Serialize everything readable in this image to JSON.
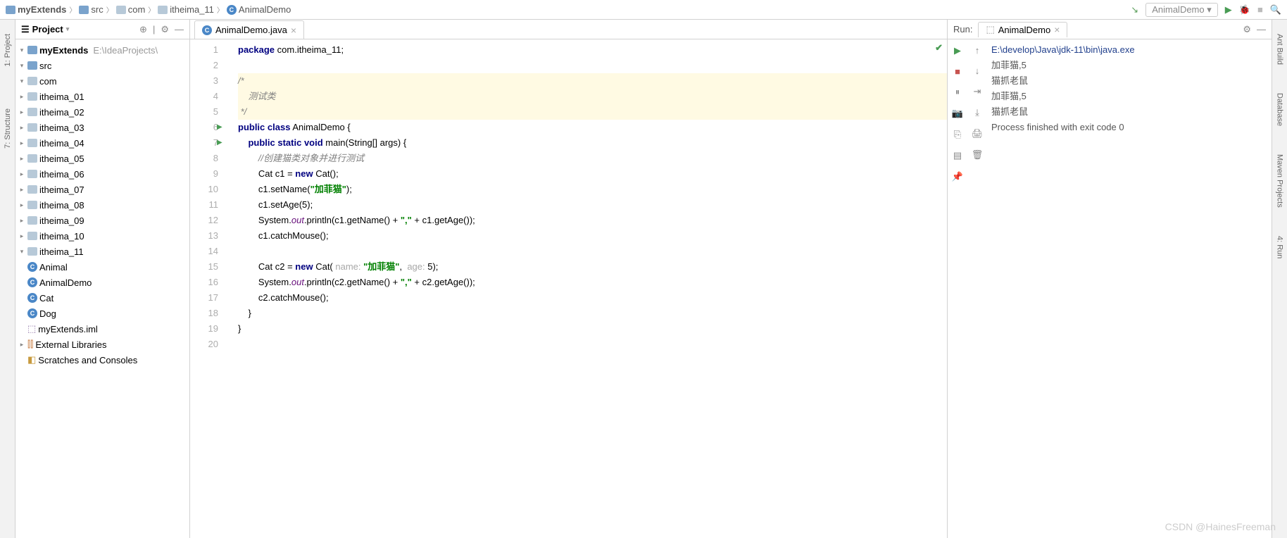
{
  "breadcrumb": [
    "myExtends",
    "src",
    "com",
    "itheima_11",
    "AnimalDemo"
  ],
  "breadcrumb_run_config": "AnimalDemo",
  "project_panel": {
    "title": "Project",
    "root": {
      "name": "myExtends",
      "path": "E:\\IdeaProjects\\"
    },
    "src": "src",
    "com": "com",
    "packages": [
      "itheima_01",
      "itheima_02",
      "itheima_03",
      "itheima_04",
      "itheima_05",
      "itheima_06",
      "itheima_07",
      "itheima_08",
      "itheima_09",
      "itheima_10",
      "itheima_11"
    ],
    "classes": [
      "Animal",
      "AnimalDemo",
      "Cat",
      "Dog"
    ],
    "iml": "myExtends.iml",
    "ext_libs": "External Libraries",
    "scratches": "Scratches and Consoles"
  },
  "editor": {
    "tab_name": "AnimalDemo.java",
    "lines": {
      "l1": {
        "pre": "",
        "kw": "package",
        "rest": " com.itheima_11;"
      },
      "l3": "/*",
      "l4": "    测试类",
      "l5": " */",
      "l6_pre": "",
      "l6_kw1": "public",
      "l6_kw2": "class",
      "l6_rest": " AnimalDemo {",
      "l7_kw1": "public",
      "l7_kw2": "static",
      "l7_kw3": "void",
      "l7_rest": " main(String[] args) {",
      "l8": "        //创建猫类对象并进行测试",
      "l9_a": "        Cat c1 = ",
      "l9_kw": "new",
      "l9_b": " Cat();",
      "l10_a": "        c1.setName(",
      "l10_s": "\"加菲猫\"",
      "l10_b": ");",
      "l11": "        c1.setAge(5);",
      "l12_a": "        System.",
      "l12_f": "out",
      "l12_b": ".println(c1.getName() + ",
      "l12_s": "\",\"",
      "l12_c": " + c1.getAge());",
      "l13": "        c1.catchMouse();",
      "l15_a": "        Cat c2 = ",
      "l15_kw": "new",
      "l15_b": " Cat( ",
      "l15_h1": "name: ",
      "l15_s": "\"加菲猫\"",
      "l15_c": ",  ",
      "l15_h2": "age: ",
      "l15_d": "5);",
      "l16_a": "        System.",
      "l16_f": "out",
      "l16_b": ".println(c2.getName() + ",
      "l16_s": "\",\"",
      "l16_c": " + c2.getAge());",
      "l17": "        c2.catchMouse();",
      "l18": "    }",
      "l19": "}"
    },
    "line_numbers": [
      "1",
      "2",
      "3",
      "4",
      "5",
      "6",
      "7",
      "8",
      "9",
      "10",
      "11",
      "12",
      "13",
      "14",
      "15",
      "16",
      "17",
      "18",
      "19",
      "20"
    ]
  },
  "run": {
    "label": "Run:",
    "tab": "AnimalDemo",
    "console": [
      {
        "cls": "path",
        "text": "E:\\develop\\Java\\jdk-11\\bin\\java.exe "
      },
      {
        "cls": "",
        "text": "加菲猫,5"
      },
      {
        "cls": "",
        "text": "猫抓老鼠"
      },
      {
        "cls": "",
        "text": "加菲猫,5"
      },
      {
        "cls": "",
        "text": "猫抓老鼠"
      },
      {
        "cls": "",
        "text": ""
      },
      {
        "cls": "",
        "text": "Process finished with exit code 0"
      }
    ]
  },
  "left_rail": [
    "1: Project",
    "7: Structure"
  ],
  "right_rail": [
    "Ant Build",
    "Database",
    "Maven Projects",
    "4: Run"
  ],
  "watermark": "CSDN @HainesFreeman"
}
